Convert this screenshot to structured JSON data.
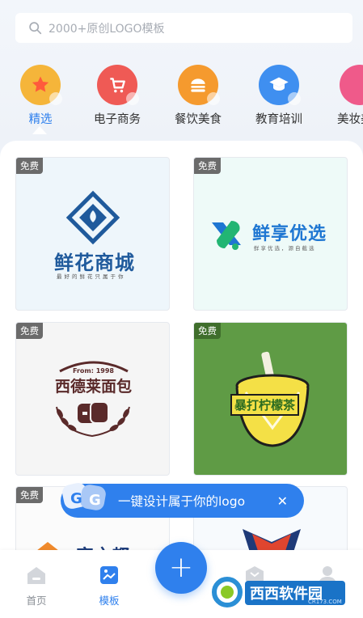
{
  "search": {
    "placeholder": "2000+原创LOGO模板"
  },
  "categories": [
    {
      "label": "精选",
      "icon": "star-icon",
      "color": "#f5b53a",
      "active": true
    },
    {
      "label": "电子商务",
      "icon": "shopping-cart-icon",
      "color": "#ef5a55",
      "active": false
    },
    {
      "label": "餐饮美食",
      "icon": "burger-icon",
      "color": "#f59a2e",
      "active": false
    },
    {
      "label": "教育培训",
      "icon": "graduation-cap-icon",
      "color": "#3f8ff0",
      "active": false
    },
    {
      "label": "美妆美",
      "icon": "cosmetics-icon",
      "color": "#ef5a8a",
      "active": false
    }
  ],
  "templates": [
    {
      "badge": "免费",
      "name": "鲜花商城",
      "sub": "最好的鲜花只属于你"
    },
    {
      "badge": "免费",
      "name": "鲜享优选",
      "sub": "鲜享优选，源自截选"
    },
    {
      "badge": "免费",
      "name": "西德莱面包",
      "sub": "From: 1998"
    },
    {
      "badge": "免费",
      "name": "暴打柠檬茶",
      "sub": ""
    },
    {
      "badge": "免费",
      "name": "宾之都",
      "sub": ""
    },
    {
      "badge": "",
      "name": "",
      "sub": ""
    }
  ],
  "tooltip": {
    "text": "一键设计属于你的logo",
    "close": "✕"
  },
  "nav": {
    "home": "首页",
    "templates": "模板",
    "fab": "+"
  },
  "watermark": {
    "text": "西西软件园",
    "url": "CR173.COM"
  },
  "colors": {
    "accent": "#2f80ed",
    "badge": "#6b6b6b"
  }
}
